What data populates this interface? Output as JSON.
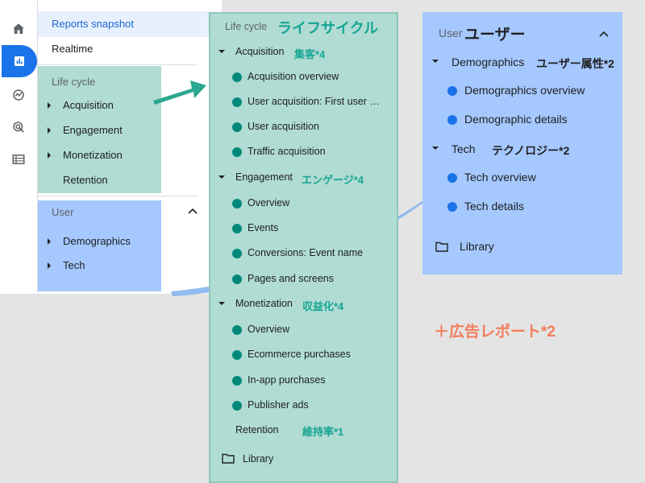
{
  "left_nav": {
    "items": {
      "reports_snapshot": "Reports snapshot",
      "realtime": "Realtime"
    },
    "lifecycle": {
      "header": "Life cycle",
      "items": [
        "Acquisition",
        "Engagement",
        "Monetization",
        "Retention"
      ]
    },
    "user": {
      "header": "User",
      "items": [
        "Demographics",
        "Tech"
      ]
    }
  },
  "lifecycle_panel": {
    "header": "Life cycle",
    "header_jp": "ライフサイクル",
    "sections": [
      {
        "label": "Acquisition",
        "jp": "集客*4",
        "items": [
          "Acquisition overview",
          "User acquisition: First user …",
          "User acquisition",
          "Traffic acquisition"
        ]
      },
      {
        "label": "Engagement",
        "jp": "エンゲージ*4",
        "items": [
          "Overview",
          "Events",
          "Conversions: Event name",
          "Pages and screens"
        ]
      },
      {
        "label": "Monetization",
        "jp": "収益化*4",
        "items": [
          "Overview",
          "Ecommerce purchases",
          "In-app purchases",
          "Publisher ads"
        ]
      }
    ],
    "retention": {
      "label": "Retention",
      "jp": "維持率*1"
    },
    "library": "Library"
  },
  "user_panel": {
    "header": "User",
    "header_jp": "ユーザー",
    "sections": [
      {
        "label": "Demographics",
        "jp": "ユーザー属性*2",
        "items": [
          "Demographics overview",
          "Demographic details"
        ]
      },
      {
        "label": "Tech",
        "jp": "テクノロジー*2",
        "items": [
          "Tech overview",
          "Tech details"
        ]
      }
    ],
    "library": "Library"
  },
  "ad_note": "＋広告レポート*2",
  "colors": {
    "teal_box": "#b0dcd3",
    "blue_box": "#a5c8ff",
    "teal_dot": "#00897b",
    "blue_dot": "#1a73e8",
    "teal_jp": "#16a594",
    "blue_jp": "#2f86e8",
    "ad_note": "#f47c5a",
    "arrow_teal": "#2aa890",
    "arrow_blue": "#7fb2f0"
  },
  "icons": [
    "home-icon",
    "reports-icon",
    "explore-icon",
    "advertising-icon",
    "configure-icon",
    "folder-icon"
  ]
}
